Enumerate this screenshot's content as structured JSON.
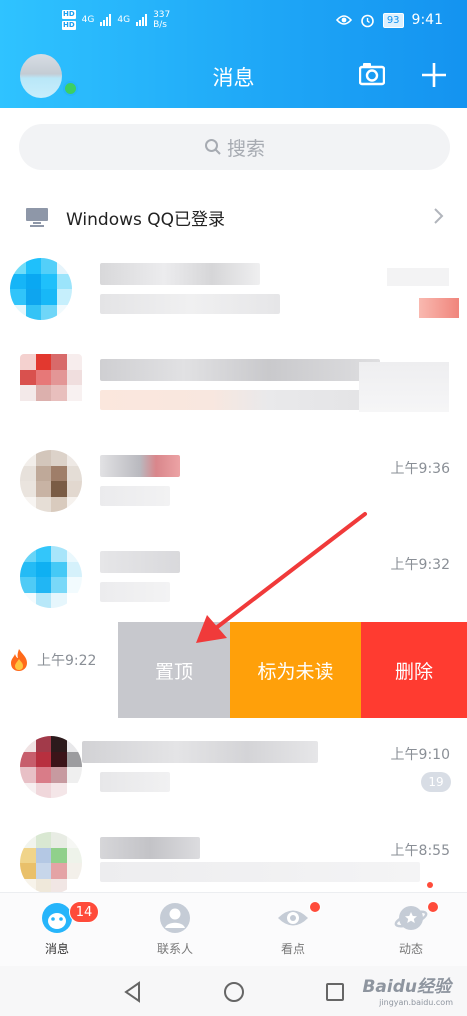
{
  "status_bar": {
    "network_speed_value": "337",
    "network_speed_unit": "B/s",
    "battery": "93",
    "time": "9:41",
    "signal_1": "4G",
    "signal_2": "4G",
    "hd": "HD"
  },
  "header": {
    "title": "消息",
    "camera_icon": "camera-icon",
    "plus_icon": "plus-icon"
  },
  "search": {
    "placeholder": "搜索"
  },
  "device_login": {
    "label": "Windows QQ已登录"
  },
  "conversations": [
    {
      "time": ""
    },
    {
      "time": ""
    },
    {
      "time": "上午9:36"
    },
    {
      "time": "上午9:32"
    },
    {
      "time": "上午9:10",
      "unread": "19"
    },
    {
      "time": "上午8:55"
    }
  ],
  "swiped_row": {
    "time": "上午9:22",
    "actions": {
      "pin": "置顶",
      "mark_unread": "标为未读",
      "delete": "删除"
    }
  },
  "bottom_nav": {
    "tabs": [
      {
        "label": "消息",
        "badge": "14"
      },
      {
        "label": "联系人"
      },
      {
        "label": "看点"
      },
      {
        "label": "动态"
      }
    ]
  },
  "watermark": {
    "brand": "Baidu经验",
    "url": "jingyan.baidu.com"
  },
  "colors": {
    "header_gradient_start": "#2fc3ff",
    "header_gradient_end": "#1493f0",
    "pin_action": "#c7c8cd",
    "mark_unread_action": "#ffa00a",
    "delete_action": "#ff3b30",
    "badge": "#ff4b3a",
    "arrow": "#f03a3a"
  }
}
